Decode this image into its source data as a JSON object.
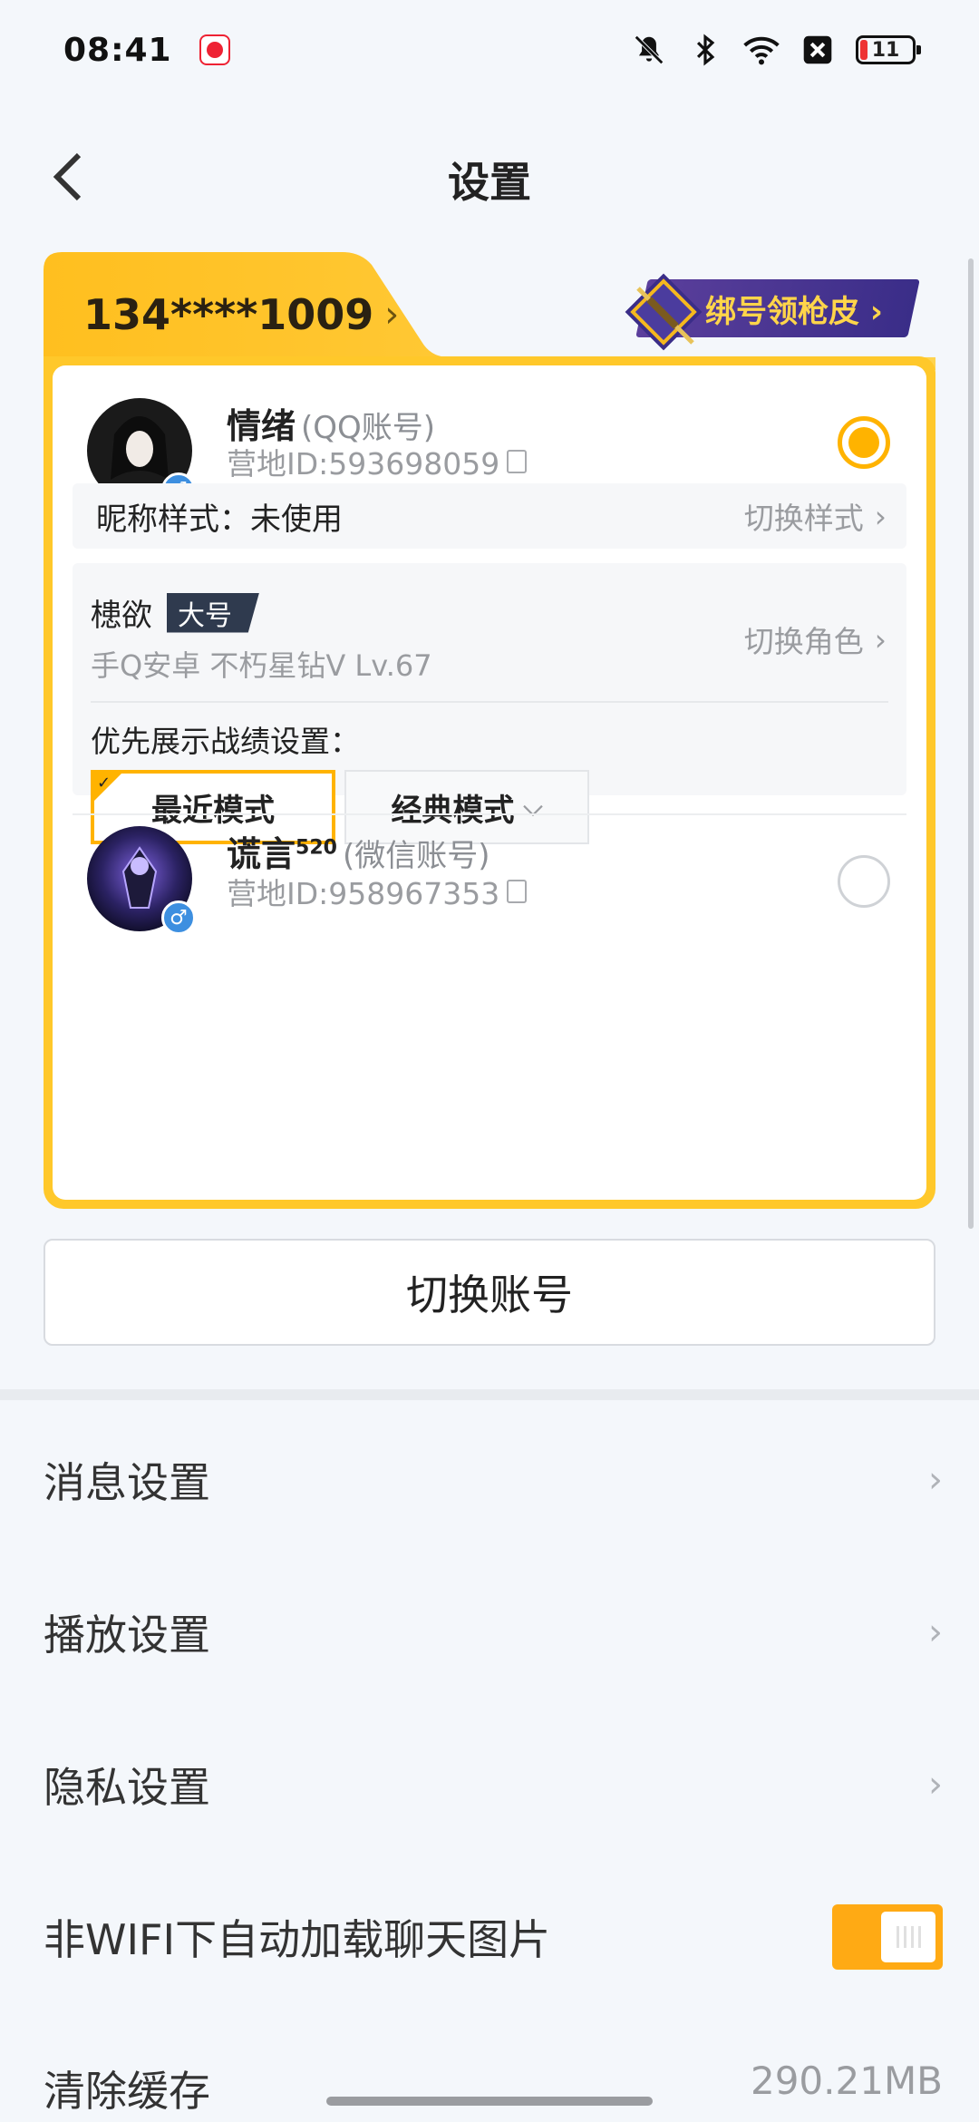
{
  "status_bar": {
    "time": "08:41",
    "battery": "11",
    "icons": [
      "app-notification-icon",
      "mute-icon",
      "bluetooth-icon",
      "wifi-icon",
      "close-box-icon",
      "battery-icon"
    ]
  },
  "header": {
    "title": "设置",
    "back_icon": "back-arrow-icon"
  },
  "account": {
    "phone": "134****1009",
    "promo_label": "绑号领枪皮",
    "promo_icon": "rifle-skin-icon",
    "primary": {
      "name": "情绪",
      "account_type": "(QQ账号)",
      "camp_id": "营地ID:593698059",
      "selected": true,
      "gender": "♂"
    },
    "nickname_style": {
      "label": "昵称样式：未使用",
      "action": "切换样式"
    },
    "role": {
      "name": "槵欲",
      "tag": "大号",
      "info": "手Q安卓  不朽星钻V  Lv.67",
      "switch_label": "切换角色",
      "priority_label": "优先展示战绩设置：",
      "mode_recent": "最近模式",
      "mode_classic": "经典模式",
      "selected_mode": "最近模式"
    },
    "secondary": {
      "name": "谎言",
      "name_sup": "520",
      "account_type": "(微信账号)",
      "camp_id": "营地ID:958967353",
      "selected": false,
      "gender": "♂"
    },
    "switch_button": "切换账号"
  },
  "menu": {
    "items": [
      {
        "label": "消息设置",
        "type": "link"
      },
      {
        "label": "播放设置",
        "type": "link"
      },
      {
        "label": "隐私设置",
        "type": "link"
      },
      {
        "label": "非WIFI下自动加载聊天图片",
        "type": "toggle",
        "on": true
      },
      {
        "label": "清除缓存",
        "type": "value",
        "value": "290.21MB"
      }
    ]
  },
  "colors": {
    "accent": "#ffb300",
    "card_yellow": "#ffc82a",
    "toggle_on": "#ffaa14",
    "promo_purple": "#4a359a",
    "gender_blue": "#3d8fe0"
  }
}
